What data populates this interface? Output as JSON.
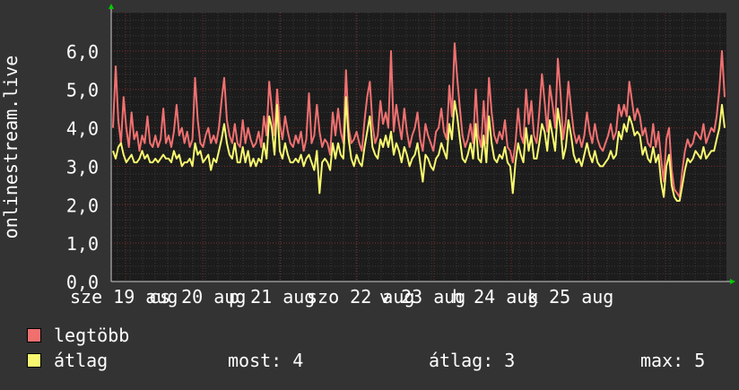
{
  "chart_data": {
    "type": "line",
    "ylabel": "onlinestream.live",
    "y_ticks": [
      "0,0",
      "1,0",
      "2,0",
      "3,0",
      "4,0",
      "5,0",
      "6,0"
    ],
    "ylim": [
      0,
      7
    ],
    "grid": true,
    "x_ticks": [
      "sze 19 aug",
      "cs 20 aug",
      "p 21 aug",
      "szo 22 aug",
      "v 23 aug",
      "h 24 aug",
      "k 25 aug"
    ],
    "series": [
      {
        "name": "legtöbb",
        "color": "#f07070",
        "values": [
          4.0,
          5.6,
          4.2,
          3.6,
          4.8,
          4.0,
          3.5,
          4.4,
          3.7,
          3.9,
          3.4,
          3.8,
          3.6,
          4.3,
          3.6,
          3.5,
          3.8,
          3.5,
          3.7,
          4.5,
          3.6,
          3.8,
          3.5,
          3.9,
          4.6,
          3.8,
          4.0,
          3.6,
          3.9,
          3.5,
          3.7,
          5.3,
          4.2,
          3.6,
          3.5,
          3.8,
          4.0,
          3.6,
          3.8,
          3.6,
          4.0,
          4.7,
          5.3,
          4.2,
          3.8,
          3.6,
          4.1,
          3.6,
          3.5,
          4.2,
          3.6,
          4.0,
          3.7,
          3.5,
          3.6,
          3.9,
          3.5,
          4.3,
          3.8,
          5.2,
          4.5,
          3.8,
          5.0,
          4.1,
          3.7,
          4.3,
          3.9,
          3.6,
          3.5,
          3.8,
          3.6,
          3.9,
          3.4,
          3.7,
          4.9,
          3.6,
          3.8,
          4.6,
          3.9,
          3.5,
          3.7,
          3.6,
          3.3,
          4.4,
          3.8,
          4.5,
          3.9,
          3.6,
          5.5,
          4.0,
          3.6,
          3.7,
          3.9,
          3.6,
          3.4,
          4.2,
          4.8,
          5.2,
          4.1,
          3.6,
          3.8,
          4.7,
          4.1,
          4.4,
          4.0,
          6.0,
          3.9,
          4.6,
          4.1,
          3.7,
          4.5,
          3.9,
          3.5,
          3.8,
          4.0,
          4.4,
          3.7,
          3.4,
          4.1,
          3.8,
          3.6,
          3.4,
          3.9,
          4.0,
          4.5,
          3.9,
          3.7,
          5.1,
          4.3,
          6.2,
          5.3,
          4.5,
          3.8,
          3.5,
          3.7,
          4.1,
          3.6,
          5.0,
          3.8,
          3.5,
          4.7,
          3.6,
          5.3,
          4.4,
          3.8,
          3.6,
          3.9,
          3.7,
          4.2,
          3.5,
          3.4,
          3.1,
          3.6,
          4.5,
          3.8,
          3.6,
          5.0,
          4.1,
          4.7,
          3.8,
          3.6,
          4.4,
          5.4,
          4.7,
          3.9,
          5.1,
          4.6,
          4.0,
          5.8,
          4.9,
          3.7,
          4.2,
          5.2,
          4.5,
          3.9,
          3.6,
          3.8,
          3.5,
          3.8,
          4.4,
          3.9,
          3.6,
          4.1,
          3.7,
          3.5,
          3.4,
          3.6,
          3.8,
          4.1,
          3.7,
          3.9,
          4.6,
          4.3,
          4.6,
          4.3,
          5.2,
          4.7,
          4.2,
          4.5,
          4.3,
          3.8,
          4.0,
          3.6,
          3.5,
          4.1,
          3.5,
          3.9,
          3.2,
          2.6,
          3.7,
          4.0,
          2.9,
          2.4,
          2.3,
          2.2,
          2.9,
          3.4,
          3.7,
          3.5,
          3.6,
          3.9,
          3.8,
          3.7,
          4.1,
          3.6,
          3.8,
          4.0,
          3.9,
          4.3,
          5.0,
          6.0,
          4.8
        ]
      },
      {
        "name": "átlag",
        "color": "#f8f870",
        "values": [
          3.4,
          3.2,
          3.5,
          3.6,
          3.3,
          3.1,
          3.2,
          3.3,
          3.1,
          3.1,
          3.2,
          3.4,
          3.2,
          3.3,
          3.1,
          3.1,
          3.2,
          3.1,
          3.2,
          3.3,
          3.2,
          3.2,
          3.1,
          3.4,
          3.2,
          3.3,
          3.0,
          3.1,
          3.1,
          3.2,
          3.0,
          3.6,
          3.3,
          3.4,
          3.1,
          3.2,
          3.3,
          2.9,
          3.2,
          3.1,
          3.4,
          3.7,
          4.1,
          3.6,
          3.3,
          3.2,
          3.6,
          3.1,
          3.1,
          3.5,
          3.1,
          3.4,
          3.0,
          3.2,
          3.0,
          3.2,
          3.1,
          3.6,
          3.2,
          4.3,
          4.0,
          3.3,
          4.6,
          3.4,
          3.2,
          3.6,
          3.3,
          3.1,
          3.1,
          3.2,
          3.1,
          3.3,
          3.0,
          3.2,
          3.3,
          3.1,
          2.9,
          3.4,
          2.3,
          3.1,
          3.2,
          3.1,
          2.9,
          3.6,
          3.2,
          3.6,
          3.3,
          3.2,
          4.8,
          3.7,
          3.2,
          3.0,
          3.3,
          3.1,
          3.0,
          3.5,
          3.9,
          4.3,
          3.5,
          3.3,
          3.2,
          3.7,
          3.5,
          3.8,
          3.5,
          3.9,
          3.3,
          3.6,
          3.4,
          3.1,
          3.5,
          3.3,
          3.0,
          3.2,
          3.3,
          3.6,
          3.1,
          2.6,
          3.3,
          3.2,
          3.0,
          2.9,
          3.2,
          3.3,
          3.6,
          3.4,
          3.2,
          4.1,
          3.7,
          4.7,
          4.3,
          3.7,
          3.2,
          3.1,
          3.3,
          3.6,
          3.2,
          4.1,
          3.2,
          3.1,
          3.8,
          3.1,
          4.3,
          3.6,
          3.2,
          3.1,
          3.3,
          3.2,
          3.5,
          3.1,
          3.0,
          2.3,
          3.1,
          3.6,
          3.3,
          3.1,
          4.0,
          3.4,
          3.8,
          3.2,
          3.2,
          3.6,
          4.1,
          3.9,
          3.4,
          4.2,
          3.8,
          3.4,
          4.5,
          4.0,
          3.2,
          3.5,
          4.2,
          3.8,
          3.3,
          3.1,
          3.2,
          3.0,
          3.3,
          3.6,
          3.3,
          3.1,
          3.4,
          3.1,
          3.0,
          3.0,
          3.1,
          3.2,
          3.4,
          3.2,
          3.3,
          3.9,
          3.7,
          4.1,
          3.9,
          4.3,
          4.1,
          3.8,
          3.9,
          3.8,
          3.3,
          3.5,
          3.2,
          3.1,
          3.5,
          3.1,
          3.3,
          2.6,
          2.2,
          3.0,
          3.3,
          2.5,
          2.2,
          2.1,
          2.1,
          2.5,
          2.9,
          3.2,
          3.1,
          3.2,
          3.4,
          3.3,
          3.2,
          3.5,
          3.2,
          3.3,
          3.4,
          3.4,
          3.7,
          4.0,
          4.6,
          4.0
        ]
      }
    ]
  },
  "legend": {
    "max_label": "legtöbb",
    "avg_label": "átlag"
  },
  "stats": {
    "current": "most: 4",
    "average": "átlag: 3",
    "max": "max: 5"
  }
}
